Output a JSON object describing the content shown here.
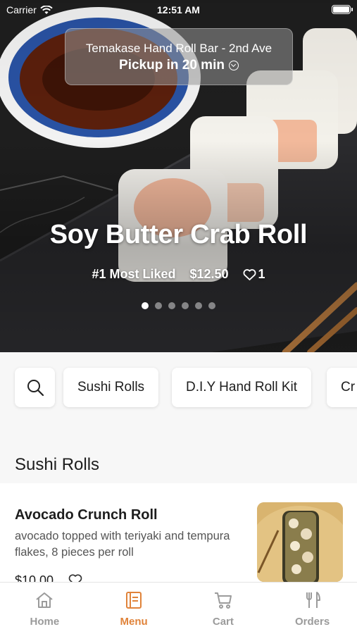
{
  "status_bar": {
    "carrier": "Carrier",
    "time": "12:51 AM"
  },
  "store": {
    "name": "Temakase Hand Roll Bar - 2nd Ave",
    "pickup": "Pickup in 20 min"
  },
  "featured": {
    "title": "Soy Butter Crab Roll",
    "badge": "#1 Most Liked",
    "price": "$12.50",
    "likes": "1",
    "slide_count": 6,
    "active_slide": 1
  },
  "categories": {
    "search_icon": "search-icon",
    "chips": [
      "Sushi Rolls",
      "D.I.Y Hand Roll Kit",
      "Cr"
    ]
  },
  "section": {
    "title": "Sushi Rolls"
  },
  "menu_items": [
    {
      "name": "Avocado Crunch Roll",
      "description": "avocado topped with teriyaki and tempura flakes, 8 pieces per roll",
      "price": "$10.00"
    }
  ],
  "tabs": [
    {
      "label": "Home",
      "icon": "home-icon",
      "active": false
    },
    {
      "label": "Menu",
      "icon": "menu-book-icon",
      "active": true
    },
    {
      "label": "Cart",
      "icon": "cart-icon",
      "active": false
    },
    {
      "label": "Orders",
      "icon": "fork-knife-icon",
      "active": false
    }
  ],
  "colors": {
    "accent": "#e0833a",
    "inactive_tab": "#9b9b9b"
  }
}
